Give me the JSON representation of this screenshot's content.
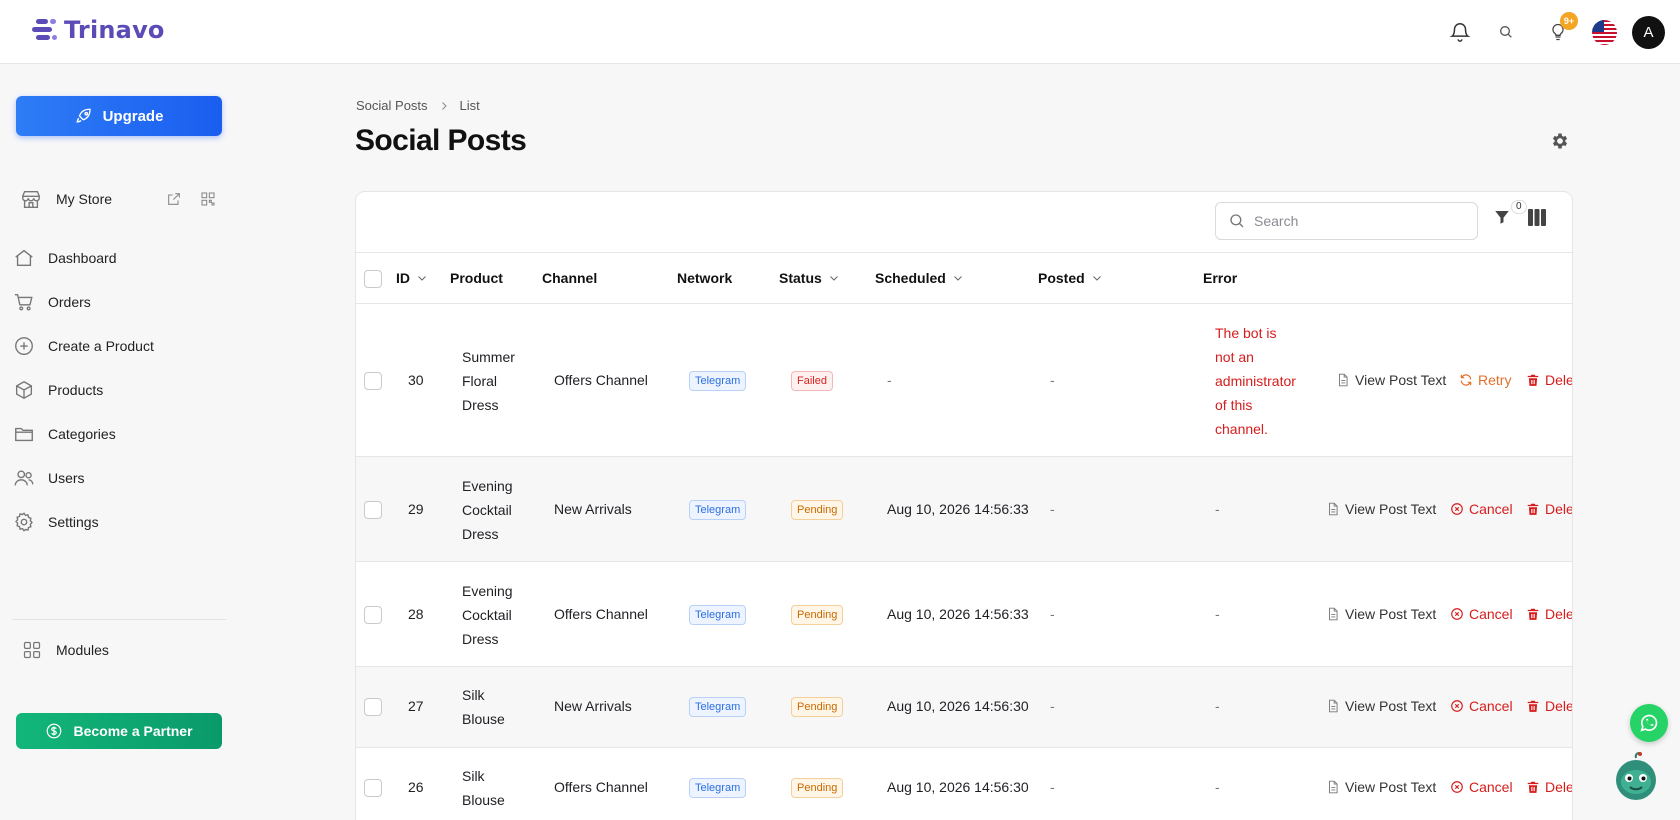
{
  "app": {
    "brand": "Trinavo",
    "notif_badge": "9+",
    "avatar_initial": "A"
  },
  "sidebar": {
    "upgrade_label": "Upgrade",
    "store_label": "My Store",
    "items": [
      {
        "label": "Dashboard",
        "icon": "home-icon"
      },
      {
        "label": "Orders",
        "icon": "cart-icon"
      },
      {
        "label": "Create a Product",
        "icon": "plus-circle-icon"
      },
      {
        "label": "Products",
        "icon": "box-icon"
      },
      {
        "label": "Categories",
        "icon": "folder-icon"
      },
      {
        "label": "Users",
        "icon": "users-icon"
      },
      {
        "label": "Settings",
        "icon": "gear-icon"
      }
    ],
    "modules_label": "Modules",
    "partner_label": "Become a Partner"
  },
  "breadcrumb": {
    "root": "Social Posts",
    "current": "List"
  },
  "page": {
    "title": "Social Posts"
  },
  "toolbar": {
    "search_placeholder": "Search",
    "filter_count": "0"
  },
  "table": {
    "columns": [
      "ID",
      "Product",
      "Channel",
      "Network",
      "Status",
      "Scheduled",
      "Posted",
      "Error"
    ],
    "actions": {
      "view": "View Post Text",
      "retry": "Retry",
      "cancel": "Cancel",
      "delete": "Dele"
    },
    "rows": [
      {
        "id": "30",
        "product": [
          "Summer",
          "Floral",
          "Dress"
        ],
        "channel": "Offers Channel",
        "network": "Telegram",
        "status": "Failed",
        "scheduled": "-",
        "posted": "-",
        "error": [
          "The bot is",
          "not an",
          "administrator",
          "of this",
          "channel."
        ]
      },
      {
        "id": "29",
        "product": [
          "Evening",
          "Cocktail",
          "Dress"
        ],
        "channel": "New Arrivals",
        "network": "Telegram",
        "status": "Pending",
        "scheduled": "Aug 10, 2026 14:56:33",
        "posted": "-",
        "error": [
          "-"
        ]
      },
      {
        "id": "28",
        "product": [
          "Evening",
          "Cocktail",
          "Dress"
        ],
        "channel": "Offers Channel",
        "network": "Telegram",
        "status": "Pending",
        "scheduled": "Aug 10, 2026 14:56:33",
        "posted": "-",
        "error": [
          "-"
        ]
      },
      {
        "id": "27",
        "product": [
          "Silk",
          "Blouse"
        ],
        "channel": "New Arrivals",
        "network": "Telegram",
        "status": "Pending",
        "scheduled": "Aug 10, 2026 14:56:30",
        "posted": "-",
        "error": [
          "-"
        ]
      },
      {
        "id": "26",
        "product": [
          "Silk",
          "Blouse"
        ],
        "channel": "Offers Channel",
        "network": "Telegram",
        "status": "Pending",
        "scheduled": "Aug 10, 2026 14:56:30",
        "posted": "-",
        "error": [
          "-"
        ]
      }
    ]
  }
}
